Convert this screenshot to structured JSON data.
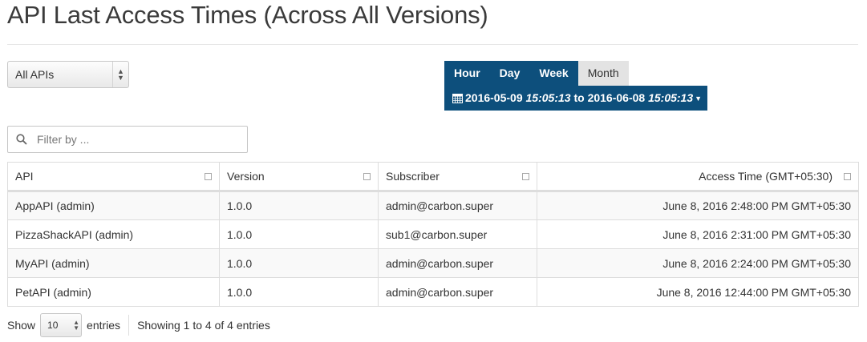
{
  "page": {
    "title": "API Last Access Times (Across All Versions)"
  },
  "api_select": {
    "value": "All APIs"
  },
  "range_tabs": [
    {
      "label": "Hour",
      "active": false
    },
    {
      "label": "Day",
      "active": false
    },
    {
      "label": "Week",
      "active": false
    },
    {
      "label": "Month",
      "active": true
    }
  ],
  "date_range": {
    "start_date": "2016-05-09",
    "start_time": "15:05:13",
    "separator": "to",
    "end_date": "2016-06-08",
    "end_time": "15:05:13",
    "icon": "calendar-icon"
  },
  "filter": {
    "placeholder": "Filter by ...",
    "value": "",
    "icon": "search-icon"
  },
  "table": {
    "columns": [
      "API",
      "Version",
      "Subscriber",
      "Access Time (GMT+05:30)"
    ],
    "rows": [
      [
        "AppAPI (admin)",
        "1.0.0",
        "admin@carbon.super",
        "June 8, 2016 2:48:00 PM GMT+05:30"
      ],
      [
        "PizzaShackAPI (admin)",
        "1.0.0",
        "sub1@carbon.super",
        "June 8, 2016 2:31:00 PM GMT+05:30"
      ],
      [
        "MyAPI (admin)",
        "1.0.0",
        "admin@carbon.super",
        "June 8, 2016 2:24:00 PM GMT+05:30"
      ],
      [
        "PetAPI (admin)",
        "1.0.0",
        "admin@carbon.super",
        "June 8, 2016 12:44:00 PM GMT+05:30"
      ]
    ]
  },
  "footer": {
    "show_label": "Show",
    "page_length": "10",
    "entries_label": "entries",
    "info": "Showing 1 to 4 of 4 entries"
  },
  "colors": {
    "accent": "#0d4f7c",
    "active_tab": "#e3e3e3"
  }
}
